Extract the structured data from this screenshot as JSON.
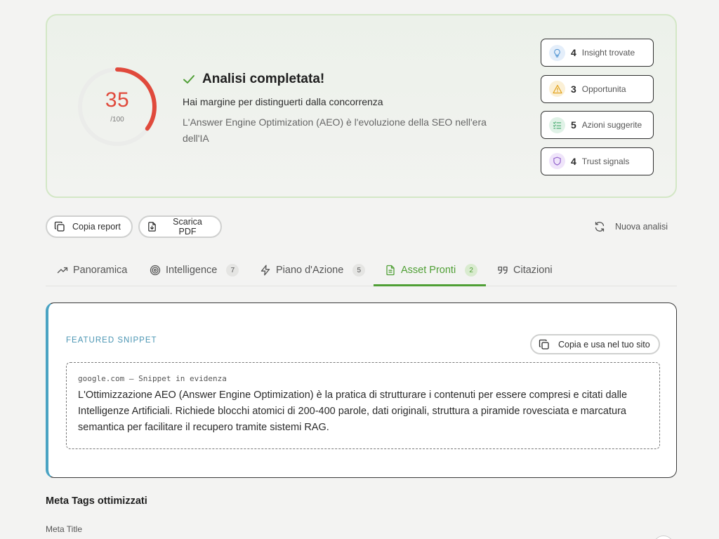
{
  "result": {
    "score": "35",
    "score_max": "/100",
    "score_fraction": 0.35,
    "score_color": "#e04a3c",
    "title": "Analisi completata!",
    "subtitle": "Hai margine per distinguerti dalla concorrenza",
    "description": "L'Answer Engine Optimization (AEO) è l'evoluzione della SEO nell'era dell'IA",
    "stats": [
      {
        "icon": "lightbulb-icon",
        "count": "4",
        "label": "Insight trovate",
        "color": "#5b9bd5"
      },
      {
        "icon": "warning-icon",
        "count": "3",
        "label": "Opportunita",
        "color": "#e2a21b"
      },
      {
        "icon": "checklist-icon",
        "count": "5",
        "label": "Azioni suggerite",
        "color": "#3fa86a"
      },
      {
        "icon": "shield-icon",
        "count": "4",
        "label": "Trust signals",
        "color": "#8e5cc9"
      }
    ]
  },
  "actions": {
    "copy_report": "Copia report",
    "download_pdf": "Scarica PDF",
    "new_analysis": "Nuova analisi"
  },
  "tabs": [
    {
      "icon": "trend-icon",
      "label": "Panoramica",
      "badge": ""
    },
    {
      "icon": "target-icon",
      "label": "Intelligence",
      "badge": "7"
    },
    {
      "icon": "lightning-icon",
      "label": "Piano d'Azione",
      "badge": "5"
    },
    {
      "icon": "document-icon",
      "label": "Asset Pronti",
      "badge": "2",
      "active": true
    },
    {
      "icon": "quote-icon",
      "label": "Citazioni",
      "badge": ""
    }
  ],
  "snippet": {
    "heading": "FEATURED SNIPPET",
    "copy_button": "Copia e usa nel tuo sito",
    "source": "google.com — Snippet in evidenza",
    "text": "L'Ottimizzazione AEO (Answer Engine Optimization) è la pratica di strutturare i contenuti per essere compresi e citati dalle Intelligenze Artificiali. Richiede blocchi atomici di 200-400 parole, dati originali, struttura a piramide rovesciata e marcatura semantica per facilitare il recupero tramite sistemi RAG.",
    "accent": "#4aa3c3"
  },
  "meta": {
    "heading": "Meta Tags ottimizzati",
    "title_label": "Meta Title"
  },
  "colors": {
    "active_tab": "#4f9f35",
    "card_border": "#d3e7c6"
  }
}
